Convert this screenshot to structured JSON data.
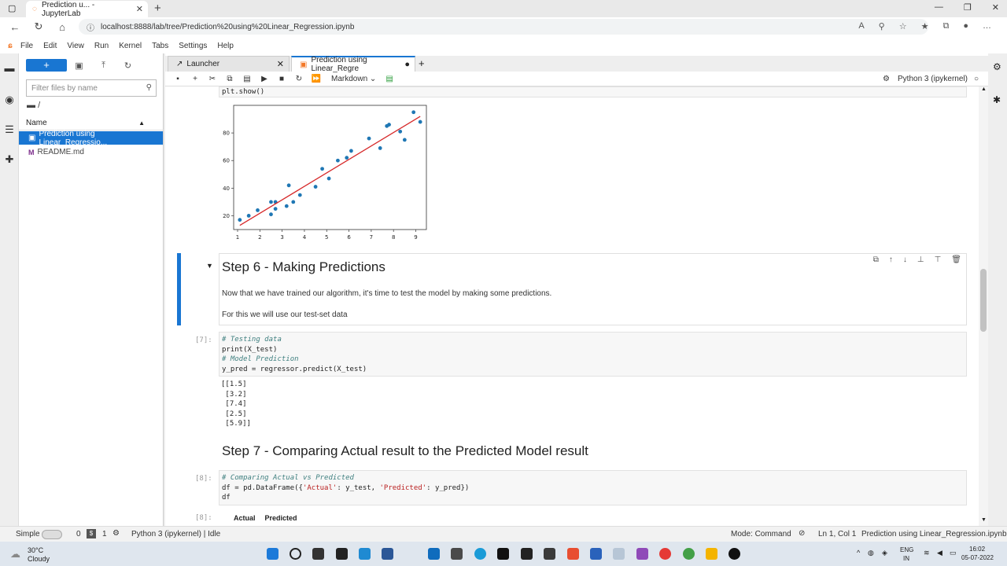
{
  "browser": {
    "tab_title": "Prediction u... - JupyterLab",
    "url": "localhost:8888/lab/tree/Prediction%20using%20Linear_Regression.ipynb"
  },
  "menu": [
    "File",
    "Edit",
    "View",
    "Run",
    "Kernel",
    "Tabs",
    "Settings",
    "Help"
  ],
  "filebrowser": {
    "plus_label": "+",
    "filter_placeholder": "Filter files by name",
    "breadcrumb": "/",
    "column_name": "Name",
    "files": [
      "Prediction using Linear_Regressio...",
      "README.md"
    ]
  },
  "doc_tabs": [
    "Launcher",
    "Prediction using Linear_Regre"
  ],
  "toolbar": {
    "cell_type": "Markdown",
    "kernel": "Python 3 (ipykernel)"
  },
  "cells": {
    "top_code": "plt.show()",
    "step6_title": "Step 6 - Making Predictions",
    "step6_p1": "Now that we have trained our algorithm, it's time to test the model by making some predictions.",
    "step6_p2": "For this we will use our test-set data",
    "cell7_prompt": "[7]:",
    "cell7_line1": "# Testing data",
    "cell7_line2": "print(X_test)",
    "cell7_line3": "# Model Prediction",
    "cell7_line4": "y_pred = regressor.predict(X_test)",
    "cell7_output": "[[1.5]\n [3.2]\n [7.4]\n [2.5]\n [5.9]]",
    "step7_title": "Step 7 - Comparing Actual result to the Predicted Model result",
    "cell8_prompt": "[8]:",
    "cell8_line1": "# Comparing Actual vs Predicted",
    "cell8_line2a": "df = pd.DataFrame({",
    "cell8_str1": "'Actual'",
    "cell8_line2b": ": y_test, ",
    "cell8_str2": "'Predicted'",
    "cell8_line2c": ": y_pred})",
    "cell8_line3": "df",
    "out8_prompt": "[8]:",
    "out8_col1": "Actual",
    "out8_col2": "Predicted"
  },
  "chart_data": {
    "type": "scatter",
    "xlim": [
      1,
      9.3
    ],
    "ylim": [
      10,
      100
    ],
    "xticks": [
      1,
      2,
      3,
      4,
      5,
      6,
      7,
      8,
      9
    ],
    "yticks": [
      20,
      40,
      60,
      80
    ],
    "points": [
      [
        1.1,
        17
      ],
      [
        1.5,
        20
      ],
      [
        1.9,
        24
      ],
      [
        2.5,
        21
      ],
      [
        2.5,
        30
      ],
      [
        2.7,
        25
      ],
      [
        2.7,
        30
      ],
      [
        3.2,
        27
      ],
      [
        3.3,
        42
      ],
      [
        3.5,
        30
      ],
      [
        3.8,
        35
      ],
      [
        4.5,
        41
      ],
      [
        4.8,
        54
      ],
      [
        5.1,
        47
      ],
      [
        5.5,
        60
      ],
      [
        5.9,
        62
      ],
      [
        6.1,
        67
      ],
      [
        6.9,
        76
      ],
      [
        7.4,
        69
      ],
      [
        7.7,
        85
      ],
      [
        7.8,
        86
      ],
      [
        8.3,
        81
      ],
      [
        8.5,
        75
      ],
      [
        8.9,
        95
      ],
      [
        9.2,
        88
      ]
    ],
    "fit_line": {
      "x": [
        1.1,
        9.2
      ],
      "y": [
        13,
        92
      ]
    },
    "point_color": "#1f77b4",
    "line_color": "#d62728"
  },
  "statusbar": {
    "mode_label": "Simple",
    "count1": "0",
    "count2": "1",
    "kernel_status": "Python 3 (ipykernel) | Idle",
    "mode": "Mode: Command",
    "position": "Ln 1, Col 1",
    "filename": "Prediction using Linear_Regression.ipynb"
  },
  "taskbar": {
    "temp": "30°C",
    "weather": "Cloudy",
    "lang1": "ENG",
    "lang2": "IN",
    "time": "16:02",
    "date": "05-07-2022"
  }
}
